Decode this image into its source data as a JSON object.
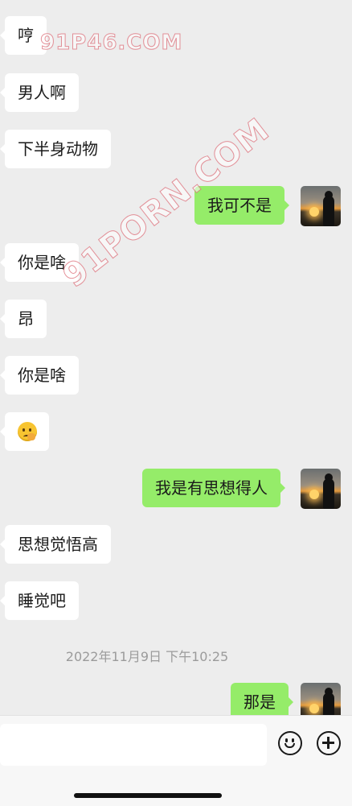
{
  "messages": [
    {
      "side": "in",
      "text": "哼"
    },
    {
      "side": "in",
      "text": "男人啊"
    },
    {
      "side": "in",
      "text": "下半身动物"
    },
    {
      "side": "out",
      "text": "我可不是"
    },
    {
      "side": "in",
      "text": "你是啥"
    },
    {
      "side": "in",
      "text": "昂"
    },
    {
      "side": "in",
      "text": "你是啥"
    },
    {
      "side": "in",
      "type": "emoji",
      "emoji": "thinking-face-emoji"
    },
    {
      "side": "out",
      "text": "我是有思想得人"
    },
    {
      "side": "in",
      "text": "思想觉悟高"
    },
    {
      "side": "in",
      "text": "睡觉吧"
    },
    {
      "side": "out",
      "text": "那是"
    }
  ],
  "timestamp": "2022年11月9日 下午10:25",
  "watermarks": [
    "91P46.COM",
    "91PORN.COM"
  ],
  "input_bar": {
    "text_value": "",
    "emoji_button_icon": "smiley-icon",
    "more_button_icon": "plus-circle-icon"
  },
  "colors": {
    "background": "#ededed",
    "incoming_bubble": "#ffffff",
    "outgoing_bubble": "#95ec69",
    "timestamp_text": "#9b9b9b"
  }
}
